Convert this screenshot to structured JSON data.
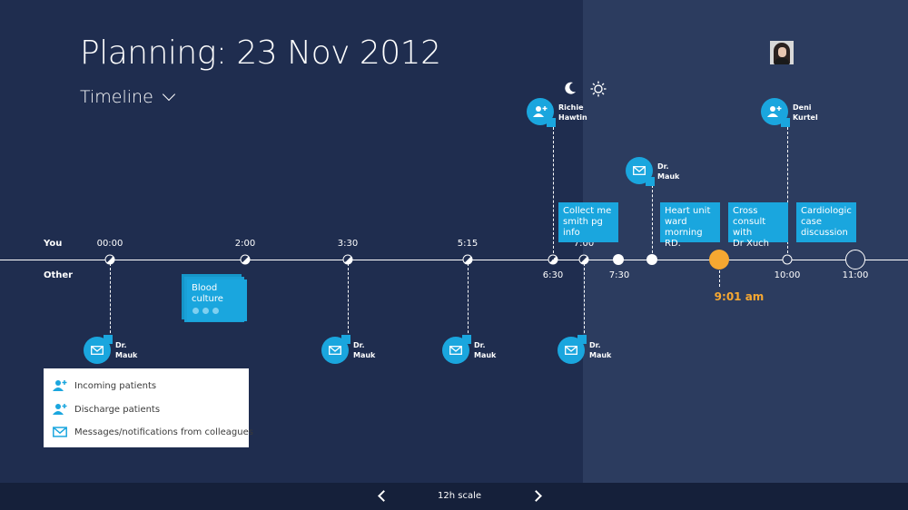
{
  "header": {
    "title": "Planning: 23 Nov 2012",
    "view_label": "Timeline"
  },
  "rows": {
    "you": "You",
    "other": "Other"
  },
  "ticks_top": [
    "00:00",
    "2:00",
    "3:30",
    "5:15",
    "7:00"
  ],
  "ticks_bottom": [
    "6:30",
    "7:30",
    "10:00",
    "11:00"
  ],
  "current_time": "9:01 am",
  "contacts": {
    "richie": [
      "Richie",
      "Hawtin"
    ],
    "mauk": [
      "Dr.",
      "Mauk"
    ],
    "deni": [
      "Deni",
      "Kurtel"
    ]
  },
  "tasks": {
    "blood": [
      "Blood",
      "culture"
    ],
    "collect": [
      "Collect me",
      "smith pg",
      "info"
    ],
    "heart": [
      "Heart unit",
      "ward",
      "morning RD."
    ],
    "cross": [
      "Cross",
      "consult with",
      "Dr Xuch"
    ],
    "cardio": [
      "Cardiologic",
      "case",
      "discussion"
    ]
  },
  "legend": {
    "incoming": "Incoming patients",
    "discharge": "Discharge patients",
    "messages": "Messages/notifications from colleagues"
  },
  "footer": {
    "scale_label": "12h scale"
  },
  "colors": {
    "accent": "#1aa6de",
    "now": "#f7a831",
    "background": "#1f2d4f"
  },
  "icons": [
    "moon-icon",
    "sun-icon",
    "add-user-icon",
    "envelope-icon",
    "chevron-down-icon",
    "chevron-left-icon",
    "chevron-right-icon"
  ]
}
